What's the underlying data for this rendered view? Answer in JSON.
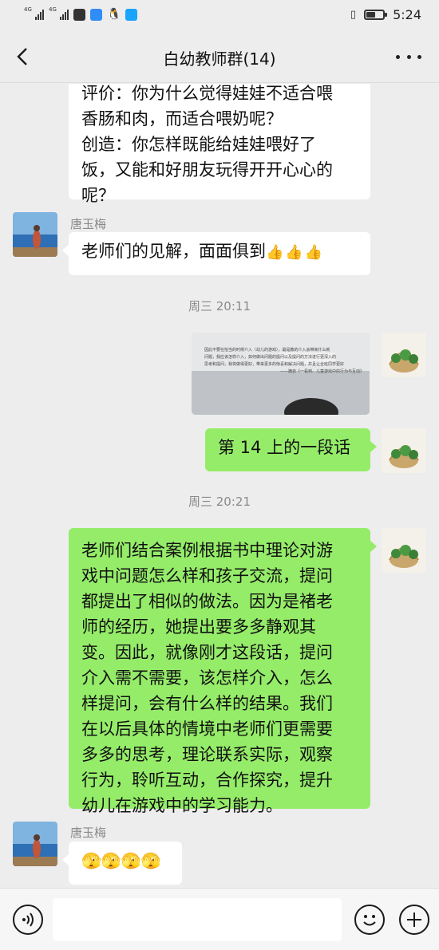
{
  "status_bar": {
    "signal1_label": "4G",
    "signal2_label": "4G",
    "battery_level": 0.55,
    "time": "5:24"
  },
  "header": {
    "title": "白幼教师群(14)",
    "back_icon": "back-arrow-icon",
    "more_icon": "more-dots-icon"
  },
  "messages": {
    "m1": {
      "lines": [
        "评价：你为什么觉得娃娃不适合喂",
        "香肠和肉，而适合喂奶呢？",
        "创造：你怎样既能给娃娃喂好了",
        "饭，又能和好朋友玩得开开心心的",
        "呢？"
      ]
    },
    "m2": {
      "sender": "唐玉梅",
      "text": "老师们的见解，面面俱到",
      "emoji": "👍👍👍"
    },
    "t1": "周三 20:11",
    "m3": {
      "image_label": "photo-of-book-page",
      "book_lines": [
        "因此不要在恰当的时候介入（幼儿的游戏），最是教的介入会带来什么新",
        "问题，我应该怎样介入，如何做出问题的提问以及提问的方法进行更深入的",
        "思考和提问，我将做得更好，带来更多的惊喜和解决问题，并且让全班同学更好",
        "——摘自《一看到、儿童游戏中的行为与互动》"
      ]
    },
    "m4": {
      "text": "第 14 上的一段话"
    },
    "t2": "周三 20:21",
    "m5": {
      "lines": [
        "老师们结合案例根据书中理论对游",
        "戏中问题怎么样和孩子交流，提问",
        "都提出了相似的做法。因为是褚老",
        "师的经历，她提出要多多静观其",
        "变。因此，就像刚才这段话，提问",
        "介入需不需要，该怎样介入，怎么",
        "样提问，会有什么样的结果。我们",
        "在以后具体的情境中老师们更需要",
        "多多的思考，理论联系实际，观察",
        "行为，聆听互动，合作探究，提升",
        "幼儿在游戏中的学习能力。"
      ]
    },
    "m6": {
      "sender": "唐玉梅",
      "emoji": "🫣🫣🫣🫣"
    }
  },
  "input_bar": {
    "voice_icon": "voice-icon",
    "emoji_icon": "emoji-icon",
    "plus_icon": "plus-icon",
    "placeholder": ""
  },
  "colors": {
    "background": "#ededed",
    "self_bubble": "#95ec69",
    "other_bubble": "#ffffff"
  }
}
